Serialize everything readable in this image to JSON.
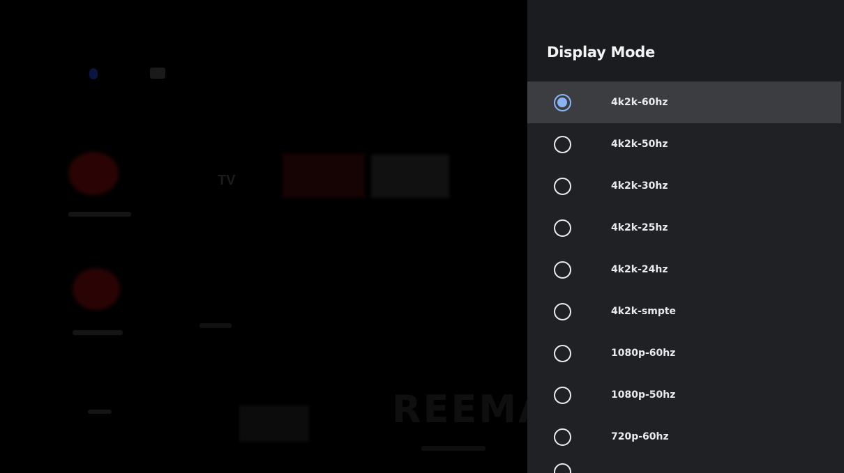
{
  "panel": {
    "title": "Display Mode",
    "selected": "4k2k-60hz",
    "accent_color": "#8ab4f8",
    "options": [
      {
        "label": "4k2k-60hz",
        "checked": true,
        "focused": true
      },
      {
        "label": "4k2k-50hz",
        "checked": false,
        "focused": false
      },
      {
        "label": "4k2k-30hz",
        "checked": false,
        "focused": false
      },
      {
        "label": "4k2k-25hz",
        "checked": false,
        "focused": false
      },
      {
        "label": "4k2k-24hz",
        "checked": false,
        "focused": false
      },
      {
        "label": "4k2k-smpte",
        "checked": false,
        "focused": false
      },
      {
        "label": "1080p-60hz",
        "checked": false,
        "focused": false
      },
      {
        "label": "1080p-50hz",
        "checked": false,
        "focused": false
      },
      {
        "label": "720p-60hz",
        "checked": false,
        "focused": false
      }
    ]
  },
  "background": {
    "tv_label": "TV",
    "brand_text": "REEMA"
  }
}
